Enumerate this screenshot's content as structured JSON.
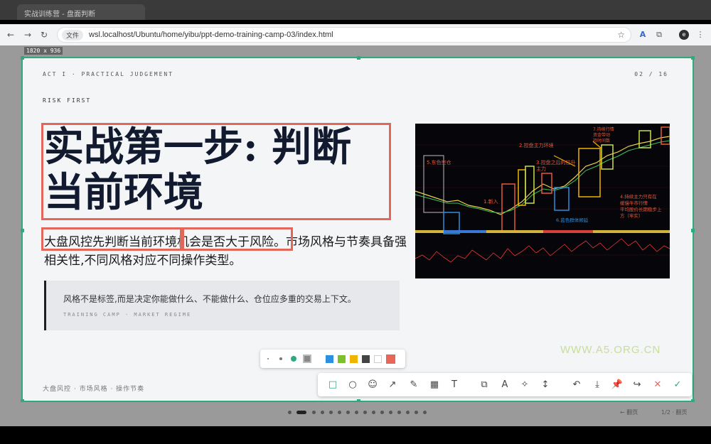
{
  "browser": {
    "tab_title": "实战训练营 - 盘面判断",
    "info_label": "文件",
    "url": "wsl.localhost/Ubuntu/home/yibu/ppt-demo-training-camp-03/index.html",
    "profile_initial": "e"
  },
  "capture": {
    "dimensions": "1820 x 936"
  },
  "slide": {
    "act_label": "ACT I · PRACTICAL JUDGEMENT",
    "page_indicator": "02 / 16",
    "kicker": "RISK FIRST",
    "title_line1": "实战第一步: 判断",
    "title_line2": "当前环境",
    "body_part1": "大盘风控先判断当前环境",
    "body_part2": "机会是否大于风险。",
    "body_part3": "市场风格与节奏具备强相关性,不同风格对应不同操作类型。",
    "quote_text": "风格不是标签,而是决定你能做什么、不能做什么、仓位应多重的交易上下文。",
    "quote_source": "TRAINING CAMP · MARKET REGIME",
    "footer": "大盘风控 · 市场风格 · 操作节奏"
  },
  "chart_labels": {
    "a1": "5.东色空仓",
    "a2": "2.控盘主力环境",
    "a3": "3.控盘之后的拉升",
    "a4": "主力",
    "a5": "7.持续行情",
    "a6": "资金带动",
    "a7": "持时间数",
    "a8": "4.持续主力只有在",
    "a9": "缓慢牛市行情",
    "a10": "平均股价长期稳步上",
    "a11": "方（牢实）",
    "a12": "1.新入",
    "a13": "6.蓝色群体顺延"
  },
  "watermark": "WWW.A5.ORG.CN",
  "palette_colors": [
    "#2d8fe0",
    "#7cc02a",
    "#f0b400",
    "#444444",
    "#ffffff",
    "#e8675a"
  ],
  "annotation_tools": [
    "rect-icon",
    "ellipse-icon",
    "emoji-icon",
    "arrow-icon",
    "pen-icon",
    "mosaic-icon",
    "text-icon",
    "pin-window-icon",
    "ocr-icon",
    "magic-icon",
    "scroll-icon",
    "undo-icon",
    "save-icon",
    "pin-icon",
    "share-icon",
    "cancel-icon",
    "confirm-icon"
  ],
  "nav": {
    "active_dot": 2,
    "total_dots": 16,
    "hint_left": "← 翻页",
    "hint_right": "1/2 · 翻页"
  }
}
